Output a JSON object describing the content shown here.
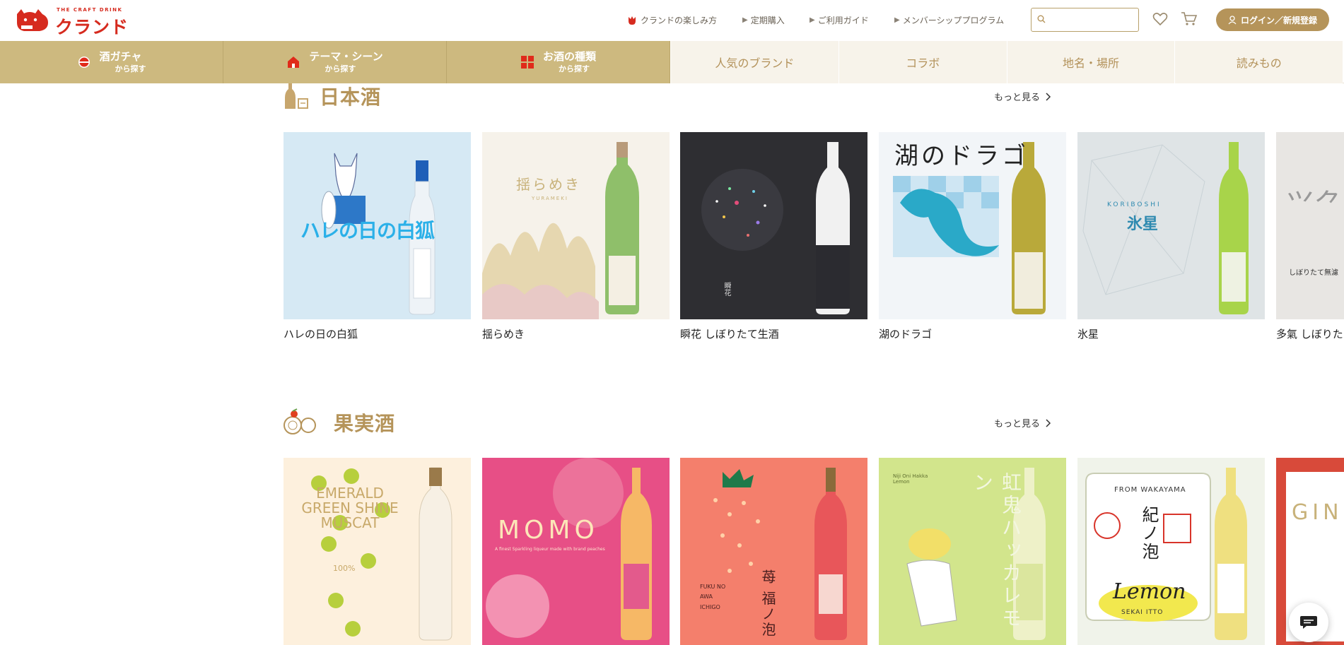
{
  "header": {
    "logo_tagline": "THE CRAFT DRINK",
    "logo_text": "クランド",
    "nav": [
      "クランドの楽しみ方",
      "定期購入",
      "ご利用ガイド",
      "メンバーシッププログラム"
    ],
    "search_placeholder": "",
    "login_label": "ログイン／新規登録"
  },
  "categories_main": [
    {
      "title": "酒ガチャ",
      "sub": "から探す",
      "icon": "gacha-icon"
    },
    {
      "title": "テーマ・シーン",
      "sub": "から探す",
      "icon": "house-icon"
    },
    {
      "title": "お酒の種類",
      "sub": "から探す",
      "icon": "grid-icon"
    }
  ],
  "categories_sub": [
    "人気のブランド",
    "コラボ",
    "地名・場所",
    "読みもの"
  ],
  "sections": [
    {
      "title": "日本酒",
      "more": "もっと見る",
      "products": [
        {
          "name": "ハレの日の白狐",
          "art_text": "ハレの日の白狐"
        },
        {
          "name": "揺らめき",
          "art_text": "揺らめき",
          "art_sub": "YURAMEKI"
        },
        {
          "name": "瞬花 しぼりたて生酒",
          "art_text": "瞬花"
        },
        {
          "name": "湖のドラゴ",
          "art_text": "湖のドラゴ"
        },
        {
          "name": "氷星",
          "art_text": "氷星",
          "art_sub": "KORIBOSHI"
        },
        {
          "name": "多氣 しぼりた",
          "art_text": "しぼりたて無濾"
        }
      ]
    },
    {
      "title": "果実酒",
      "more": "もっと見る",
      "products": [
        {
          "name": "",
          "art_text": "EMERALD GREEN SHINE MUSCAT",
          "art_sub": "100%"
        },
        {
          "name": "",
          "art_text": "MOMO",
          "art_sub": "A finest Sparkling liqueur made with brand peaches"
        },
        {
          "name": "",
          "art_text": "苺 福ノ泡",
          "art_sub": "FUKU NO AWA ICHIGO"
        },
        {
          "name": "",
          "art_text": "虹鬼ハッカレモン",
          "art_sub": "Niji Oni Hakka Lemon"
        },
        {
          "name": "",
          "art_text": "紀ノ泡",
          "art_sub": "FROM WAKAYAMA",
          "art_sub2": "Lemon",
          "art_sub3": "SEKAI ITTO"
        },
        {
          "name": "",
          "art_text": "GIN"
        }
      ]
    }
  ],
  "colors": {
    "brand_red": "#d62b1f",
    "gold": "#b5945a",
    "category_bg": "#cdb97f",
    "sub_bg": "#f7f3ea"
  }
}
